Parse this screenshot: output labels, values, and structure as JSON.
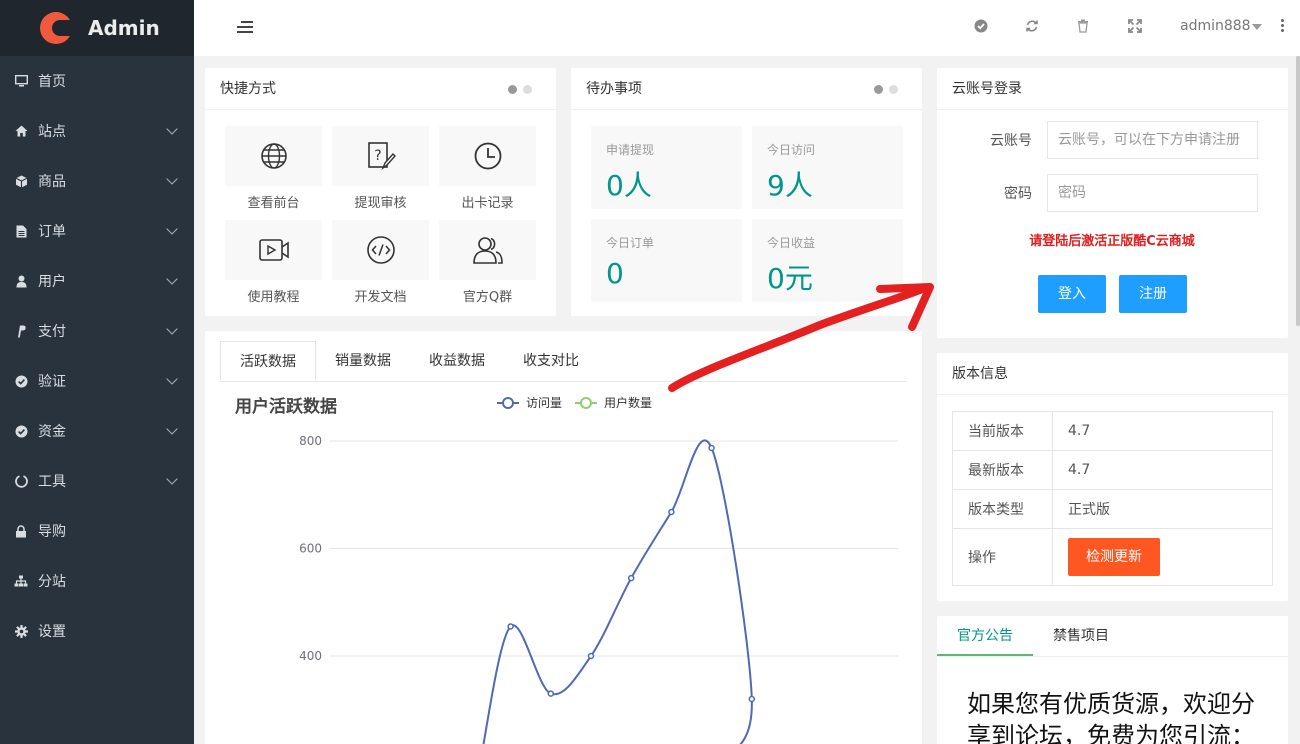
{
  "brand": {
    "name": "Admin"
  },
  "sidebar": {
    "items": [
      {
        "label": "首页",
        "icon": "monitor-icon",
        "has_children": false
      },
      {
        "label": "站点",
        "icon": "home-icon",
        "has_children": true
      },
      {
        "label": "商品",
        "icon": "cube-icon",
        "has_children": true
      },
      {
        "label": "订单",
        "icon": "file-icon",
        "has_children": true
      },
      {
        "label": "用户",
        "icon": "user-icon",
        "has_children": true
      },
      {
        "label": "支付",
        "icon": "paypal-icon",
        "has_children": true
      },
      {
        "label": "验证",
        "icon": "check-circle-icon",
        "has_children": true
      },
      {
        "label": "资金",
        "icon": "check-circle-icon",
        "has_children": true
      },
      {
        "label": "工具",
        "icon": "circle-notch-icon",
        "has_children": true
      },
      {
        "label": "导购",
        "icon": "lock-icon",
        "has_children": false
      },
      {
        "label": "分站",
        "icon": "sitemap-icon",
        "has_children": false
      },
      {
        "label": "设置",
        "icon": "gear-icon",
        "has_children": false
      }
    ]
  },
  "header": {
    "username": "admin888"
  },
  "shortcuts": {
    "title": "快捷方式",
    "items": [
      {
        "label": "查看前台",
        "icon": "globe-icon"
      },
      {
        "label": "提现审核",
        "icon": "question-edit-icon"
      },
      {
        "label": "出卡记录",
        "icon": "clock-icon"
      },
      {
        "label": "使用教程",
        "icon": "video-icon"
      },
      {
        "label": "开发文档",
        "icon": "code-icon"
      },
      {
        "label": "官方Q群",
        "icon": "users-icon"
      }
    ]
  },
  "todo": {
    "title": "待办事项",
    "items": [
      {
        "label": "申请提现",
        "value": "0人"
      },
      {
        "label": "今日访问",
        "value": "9人"
      },
      {
        "label": "今日订单",
        "value": "0"
      },
      {
        "label": "今日收益",
        "value": "0元"
      }
    ]
  },
  "cloud_login": {
    "title": "云账号登录",
    "account_label": "云账号",
    "account_placeholder": "云账号，可以在下方申请注册",
    "password_label": "密码",
    "password_placeholder": "密码",
    "warning": "请登陆后激活正版酷C云商城",
    "login_label": "登入",
    "register_label": "注册"
  },
  "version": {
    "title": "版本信息",
    "rows": [
      {
        "key": "当前版本",
        "value": "4.7"
      },
      {
        "key": "最新版本",
        "value": "4.7"
      },
      {
        "key": "版本类型",
        "value": "正式版"
      }
    ],
    "action_key": "操作",
    "action_button": "检测更新"
  },
  "data_tabs": [
    "活跃数据",
    "销量数据",
    "收益数据",
    "收支对比"
  ],
  "notice": {
    "tabs": [
      "官方公告",
      "禁售项目"
    ],
    "text": "如果您有优质货源，欢迎分享到论坛，免费为您引流："
  },
  "colors": {
    "accent": "#009688",
    "sidebar": "#28333e",
    "blue": "#1e9fff",
    "orange": "#ff5722",
    "warn": "#e02020",
    "series1": "#4f69b5",
    "series2": "#91cc75",
    "arrow": "#e52020"
  },
  "chart_data": {
    "type": "line",
    "title": "用户活跃数据",
    "legend_position": "top",
    "series": [
      {
        "name": "访问量",
        "values": [
          null,
          null,
          null,
          455,
          330,
          400,
          545,
          668,
          787,
          320
        ]
      },
      {
        "name": "用户数量",
        "values": []
      }
    ],
    "ylim": [
      300,
      800
    ],
    "yticks": [
      800,
      600,
      400
    ],
    "grid": true
  }
}
